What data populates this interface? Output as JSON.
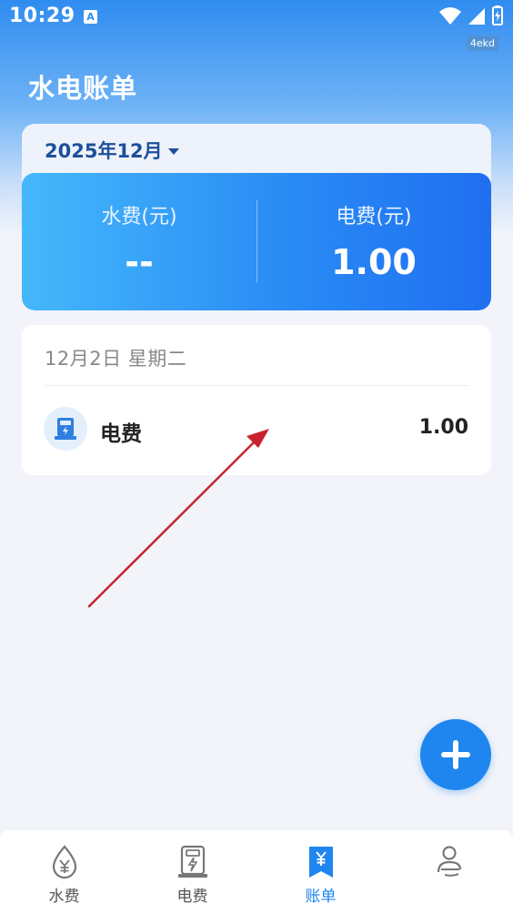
{
  "status_bar": {
    "time": "10:29",
    "notification_glyph": "A",
    "watermark": "4ekd"
  },
  "header": {
    "title": "水电账单"
  },
  "summary": {
    "month": "2025年12月",
    "water": {
      "label": "水费(元)",
      "value": "--"
    },
    "electric": {
      "label": "电费(元)",
      "value": "1.00"
    }
  },
  "records": [
    {
      "date": "12月2日 星期二",
      "items": [
        {
          "icon": "electric-meter-icon",
          "name": "电费",
          "amount": "1.00"
        }
      ]
    }
  ],
  "tabs": [
    {
      "label": "水费",
      "icon": "water-drop-yuan-icon",
      "active": false
    },
    {
      "label": "电费",
      "icon": "electric-meter-icon",
      "active": false
    },
    {
      "label": "账单",
      "icon": "bill-bookmark-icon",
      "active": true
    },
    {
      "label": "",
      "icon": "profile-icon",
      "active": false
    }
  ],
  "colors": {
    "primary": "#1f86f0",
    "title_text": "#1d4f9b",
    "arrow": "#c8232c"
  }
}
